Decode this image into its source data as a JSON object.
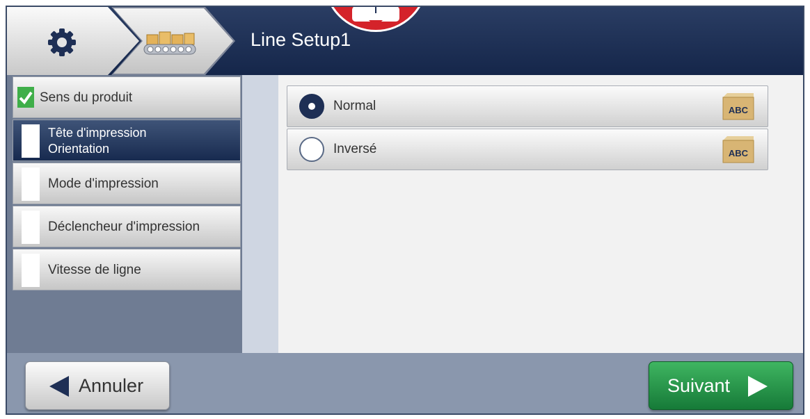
{
  "header": {
    "title": "Line Setup1",
    "breadcrumb": [
      {
        "icon": "gear-icon"
      },
      {
        "icon": "conveyor-belt-icon"
      }
    ]
  },
  "sidebar": {
    "steps": [
      {
        "label": "Sens du produit",
        "state": "completed"
      },
      {
        "label_line1": "Tête d'impression",
        "label_line2": "Orientation",
        "state": "active"
      },
      {
        "label": "Mode d'impression",
        "state": "pending"
      },
      {
        "label": "Déclencheur d'impression",
        "state": "pending"
      },
      {
        "label": "Vitesse de ligne",
        "state": "pending"
      }
    ]
  },
  "options": [
    {
      "label": "Normal",
      "selected": true,
      "icon": "box-abc-icon",
      "icon_text": "ABC"
    },
    {
      "label": "Inversé",
      "selected": false,
      "icon": "box-abc-inverted-icon",
      "icon_text": "ABC"
    }
  ],
  "footer": {
    "cancel_label": "Annuler",
    "next_label": "Suivant"
  },
  "colors": {
    "header_bg": "#1e2f55",
    "accent_green": "#1f8f45",
    "check_green": "#3fae49",
    "alarm_red": "#d4232a"
  }
}
